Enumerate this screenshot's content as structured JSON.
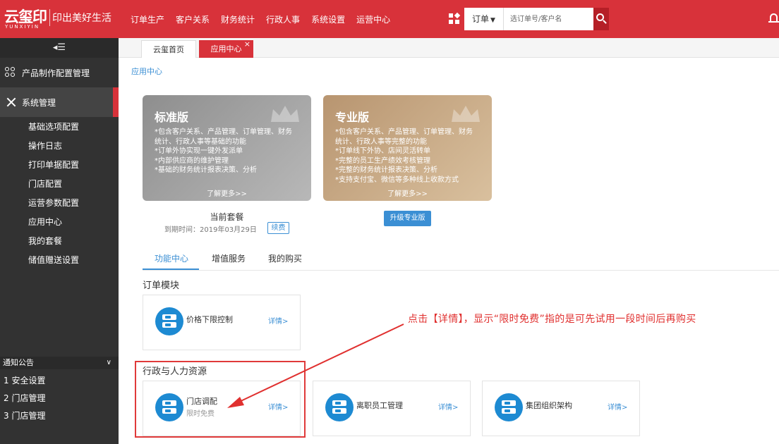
{
  "header": {
    "logo_mark": "云玺印",
    "logo_sub": "YUNXIYIN",
    "slogan": "印出美好生活",
    "nav": [
      "订单生产",
      "客户关系",
      "财务统计",
      "行政人事",
      "系统设置",
      "运营中心"
    ],
    "search_type": "订单",
    "search_placeholder": "选订单号/客户名"
  },
  "sidebar": {
    "collapse_glyph": "◂☰",
    "groups": [
      {
        "label": "产品制作配置管理",
        "icon": "grid-circles-icon"
      },
      {
        "label": "系统管理",
        "icon": "tools-icon"
      }
    ],
    "sub_items": [
      "基础选项配置",
      "操作日志",
      "打印单据配置",
      "门店配置",
      "运营参数配置",
      "应用中心",
      "我的套餐",
      "储值赠送设置"
    ],
    "notice_title": "通知公告",
    "notices": [
      "1 安全设置",
      "2 门店管理",
      "3 门店管理"
    ]
  },
  "tabs": [
    {
      "label": "云玺首页"
    },
    {
      "label": "应用中心",
      "close": "×"
    }
  ],
  "breadcrumb": "应用中心",
  "plans": {
    "standard": {
      "title": "标准版",
      "features": [
        "*包含客户关系、产品管理、订单管理、财务",
        "统计、行政人事等基础的功能",
        "*订单外协实现一键外发派单",
        "*内部供应商的维护管理",
        "*基础的财务统计报表决策、分析"
      ],
      "more": "了解更多>>"
    },
    "pro": {
      "title": "专业版",
      "features": [
        "*包含客户关系、产品管理、订单管理、财务",
        "统计、行政人事等完整的功能",
        "*订单线下外协、店间灵活转单",
        "*完整的员工生产绩效考核管理",
        "*完整的财务统计报表决策、分析",
        "*支持支付宝、微信等多种线上收款方式"
      ],
      "more": "了解更多>>"
    },
    "current_label": "当前套餐",
    "expire_text": "到期时间：2019年03月29日",
    "renew_label": "续费",
    "upgrade_label": "升级专业版"
  },
  "func_tabs": [
    "功能中心",
    "增值服务",
    "我的购买"
  ],
  "sections": [
    {
      "title": "订单模块",
      "modules": [
        {
          "name": "价格下限控制",
          "detail": "详情>"
        }
      ]
    },
    {
      "title": "行政与人力资源",
      "modules": [
        {
          "name": "门店调配",
          "sub": "限时免费",
          "detail": "详情>"
        },
        {
          "name": "离职员工管理",
          "detail": "详情>"
        },
        {
          "name": "集团组织架构",
          "detail": "详情>"
        }
      ]
    }
  ],
  "annotation": {
    "text": "点击【详情】，显示“限时免费”指的是可先试用一段时间后再购买",
    "color": "#e0302f"
  },
  "colors": {
    "brand": "#d8323a",
    "accent": "#3b8fd4",
    "module_icon": "#1d8ad2"
  }
}
